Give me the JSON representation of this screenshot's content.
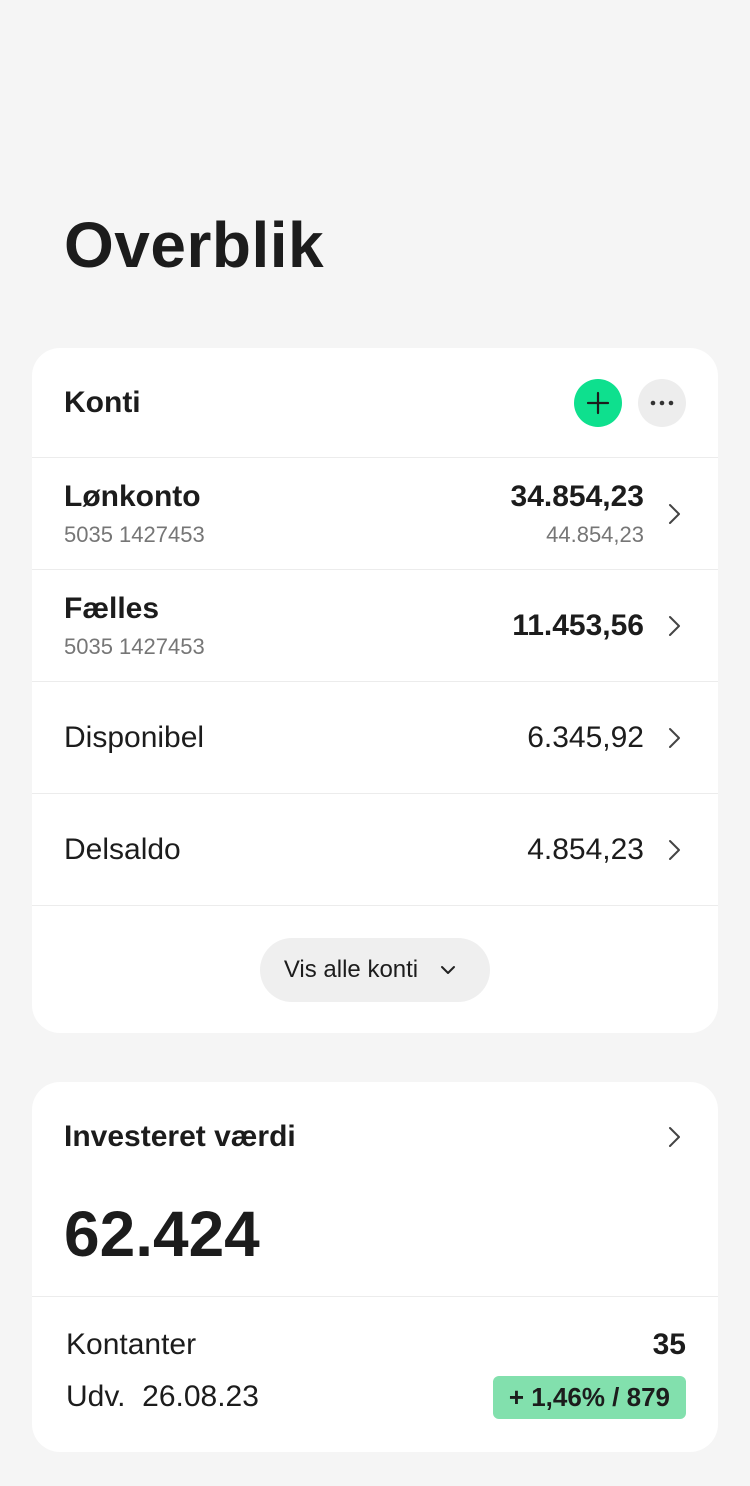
{
  "page": {
    "title": "Overblik"
  },
  "accounts_card": {
    "title": "Konti",
    "rows": [
      {
        "name": "Lønkonto",
        "number": "5035 1427453",
        "amount": "34.854,23",
        "sub_amount": "44.854,23"
      },
      {
        "name": "Fælles",
        "number": "5035 1427453",
        "amount": "11.453,56"
      },
      {
        "name": "Disponibel",
        "amount": "6.345,92"
      },
      {
        "name": "Delsaldo",
        "amount": "4.854,23"
      }
    ],
    "show_all_label": "Vis alle konti"
  },
  "invest_card": {
    "title": "Investeret værdi",
    "value": "62.424",
    "cash_label": "Kontanter",
    "cash_value": "35",
    "dev_label": "Udv.",
    "dev_date": "26.08.23",
    "dev_badge": "+ 1,46% / 879"
  },
  "colors": {
    "accent": "#0ee08e",
    "badge": "#82e0ad"
  }
}
